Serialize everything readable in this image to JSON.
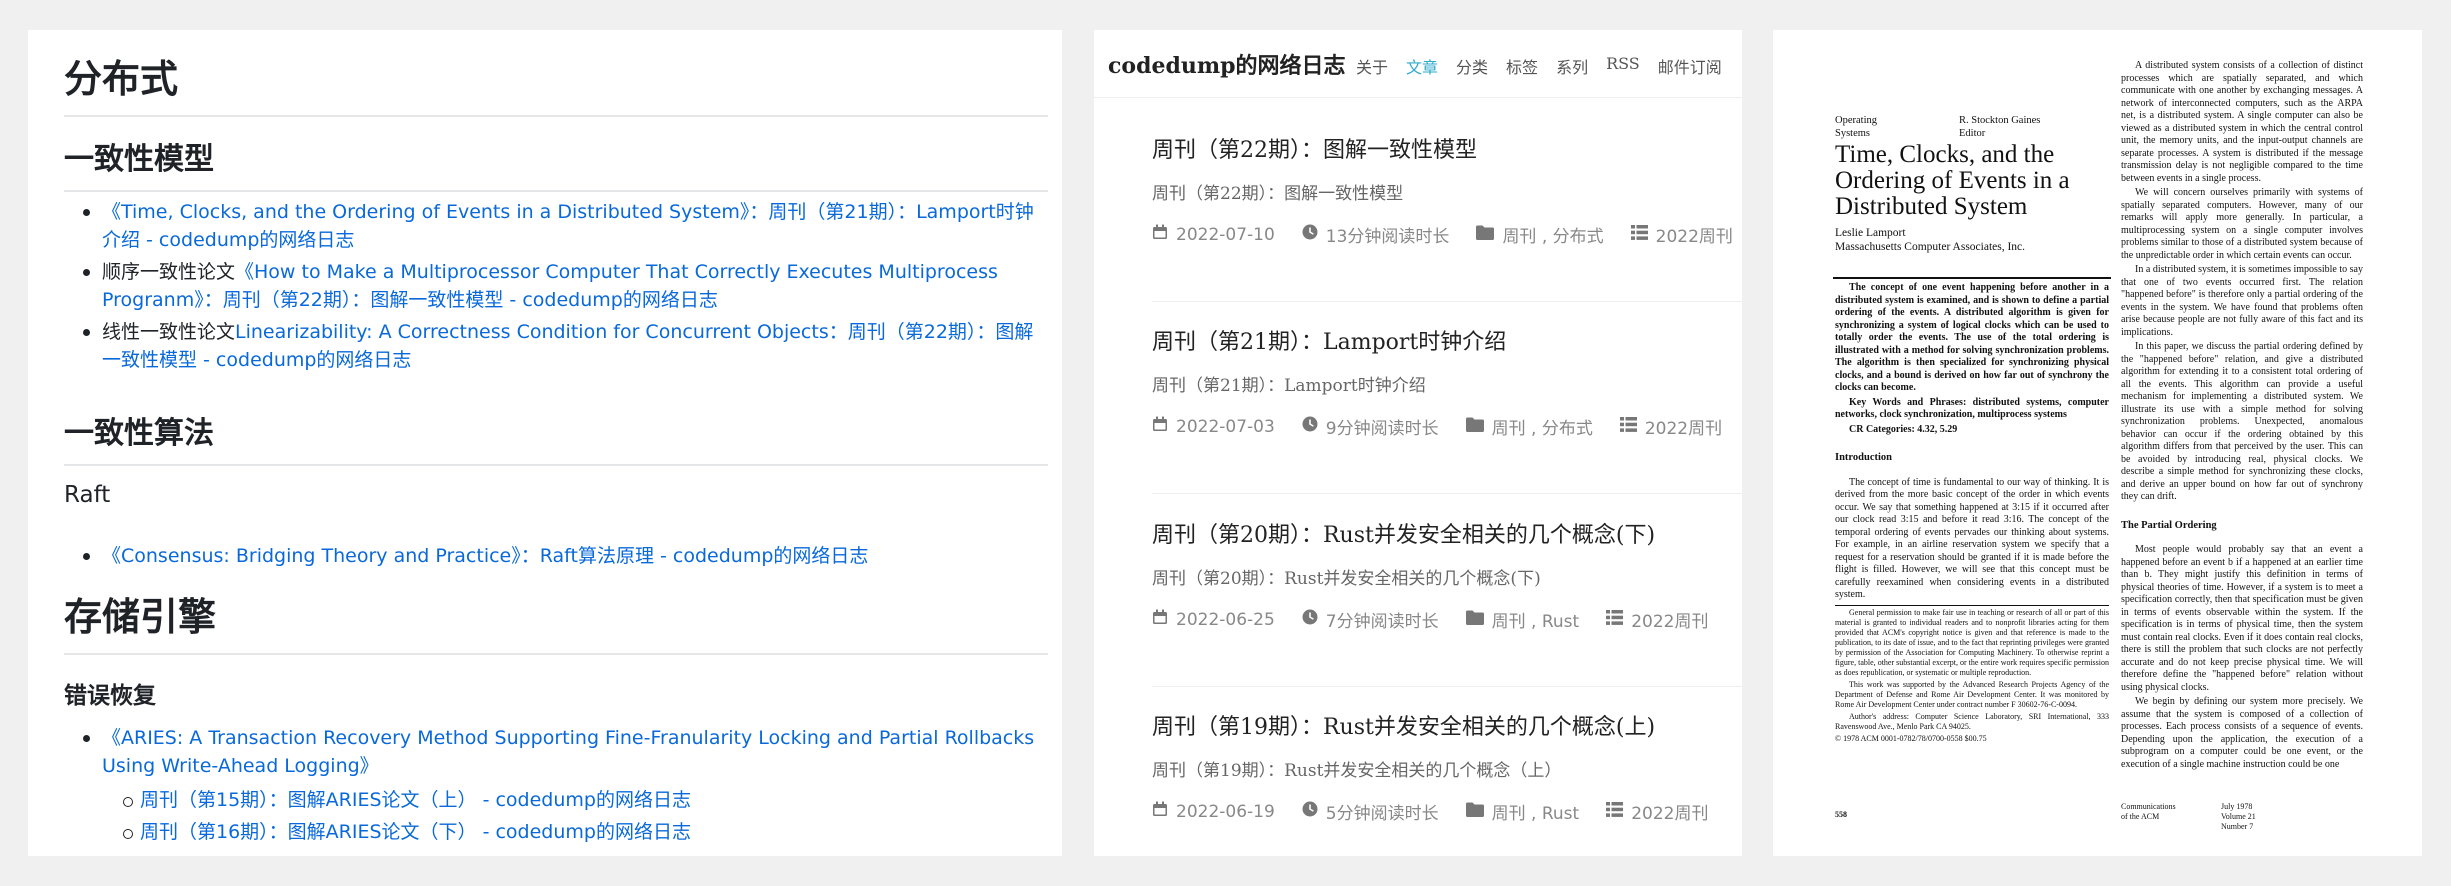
{
  "markdown_panel": {
    "h1_distributed": "分布式",
    "h2_consistency_model": "一致性模型",
    "consistency_items": [
      {
        "pre": "",
        "link": "《Time, Clocks, and the Ordering of Events in a Distributed System》：周刊（第21期）：Lamport时钟介绍 - codedump的网络日志"
      },
      {
        "pre": "顺序一致性论文",
        "link": "《How to Make a Multiprocessor Computer That Correctly Executes Multiprocess Progranm》：周刊（第22期）：图解一致性模型 - codedump的网络日志"
      },
      {
        "pre": "线性一致性论文",
        "link": "Linearizability: A Correctness Condition for Concurrent Objects：周刊（第22期）：图解一致性模型 - codedump的网络日志"
      }
    ],
    "h2_consistency_algo": "一致性算法",
    "h3_raft": "Raft",
    "raft_item": "《Consensus: Bridging Theory and Practice》：Raft算法原理 - codedump的网络日志",
    "h1_storage": "存储引擎",
    "h4_error_recovery": "错误恢复",
    "aries_item": "《ARIES: A Transaction Recovery Method Supporting Fine-Franularity Locking and Partial Rollbacks Using Write-Ahead Logging》",
    "aries_subitems": [
      "周刊（第15期）：图解ARIES论文（上） - codedump的网络日志",
      "周刊（第16期）：图解ARIES论文（下） - codedump的网络日志"
    ]
  },
  "blog_panel": {
    "site_title": "codedump的网络日志",
    "menu": [
      "关于",
      "文章",
      "分类",
      "标签",
      "系列",
      "RSS",
      "邮件订阅"
    ],
    "active_menu": "文章",
    "posts": [
      {
        "title": "周刊（第22期）：图解一致性模型",
        "subtitle": "周刊（第22期）：图解一致性模型",
        "date": "2022-07-10",
        "read": "13分钟阅读时长",
        "categories": "周刊 , 分布式",
        "series": "2022周刊"
      },
      {
        "title": "周刊（第21期）：Lamport时钟介绍",
        "subtitle": "周刊（第21期）：Lamport时钟介绍",
        "date": "2022-07-03",
        "read": "9分钟阅读时长",
        "categories": "周刊 , 分布式",
        "series": "2022周刊"
      },
      {
        "title": "周刊（第20期）：Rust并发安全相关的几个概念(下)",
        "subtitle": "周刊（第20期）：Rust并发安全相关的几个概念(下)",
        "date": "2022-06-25",
        "read": "7分钟阅读时长",
        "categories": "周刊 , Rust",
        "series": "2022周刊"
      },
      {
        "title": "周刊（第19期）：Rust并发安全相关的几个概念(上)",
        "subtitle": "周刊（第19期）：Rust并发安全相关的几个概念（上）",
        "date": "2022-06-19",
        "read": "5分钟阅读时长",
        "categories": "周刊 , Rust",
        "series": "2022周刊"
      }
    ]
  },
  "paper_panel": {
    "section_label_1": "Operating",
    "section_label_2": "Systems",
    "editor_name": "R. Stockton Gaines",
    "editor_label": "Editor",
    "title": "Time, Clocks, and the Ordering of Events in a Distributed System",
    "author": "Leslie Lamport",
    "affiliation": "Massachusetts Computer Associates, Inc.",
    "abstract": "The concept of one event happening before another in a distributed system is examined, and is shown to define a partial ordering of the events. A distributed algorithm is given for synchronizing a system of logical clocks which can be used to totally order the events. The use of the total ordering is illustrated with a method for solving synchronization problems. The algorithm is then specialized for synchronizing physical clocks, and a bound is derived on how far out of synchrony the clocks can become.",
    "keywords": "Key Words and Phrases: distributed systems, computer networks, clock synchronization, multiprocess systems",
    "cr_categories": "CR Categories: 4.32, 5.29",
    "intro_heading": "Introduction",
    "intro_text": "The concept of time is fundamental to our way of thinking. It is derived from the more basic concept of the order in which events occur. We say that something happened at 3:15 if it occurred after our clock read 3:15 and before it read 3:16. The concept of the temporal ordering of events pervades our thinking about systems. For example, in an airline reservation system we specify that a request for a reservation should be granted if it is made before the flight is filled. However, we will see that this concept must be carefully reexamined when considering events in a distributed system.",
    "permission": "General permission to make fair use in teaching or research of all or part of this material is granted to individual readers and to nonprofit libraries acting for them provided that ACM's copyright notice is given and that reference is made to the publication, to its date of issue, and to the fact that reprinting privileges were granted by permission of the Association for Computing Machinery. To otherwise reprint a figure, table, other substantial excerpt, or the entire work requires specific permission as does republication, or systematic or multiple reproduction.",
    "support": "This work was supported by the Advanced Research Projects Agency of the Department of Defense and Rome Air Development Center. It was monitored by Rome Air Development Center under contract number F 30602-76-C-0094.",
    "address": "Author's address: Computer Science Laboratory, SRI International, 333 Ravenswood Ave., Menlo Park CA 94025.",
    "copyright": "© 1978 ACM 0001-0782/78/0700-0558 $00.75",
    "page_number": "558",
    "footer_journal": "Communications of the ACM",
    "footer_date": "July 1978",
    "footer_volume": "Volume 21",
    "footer_number": "Number 7",
    "right_p1": "A distributed system consists of a collection of distinct processes which are spatially separated, and which communicate with one another by exchanging messages. A network of interconnected computers, such as the ARPA net, is a distributed system. A single computer can also be viewed as a distributed system in which the central control unit, the memory units, and the input-output channels are separate processes. A system is distributed if the message transmission delay is not negligible compared to the time between events in a single process.",
    "right_p2": "We will concern ourselves primarily with systems of spatially separated computers. However, many of our remarks will apply more generally. In particular, a multiprocessing system on a single computer involves problems similar to those of a distributed system because of the unpredictable order in which certain events can occur.",
    "right_p3": "In a distributed system, it is sometimes impossible to say that one of two events occurred first. The relation \"happened before\" is therefore only a partial ordering of the events in the system. We have found that problems often arise because people are not fully aware of this fact and its implications.",
    "right_p4": "In this paper, we discuss the partial ordering defined by the \"happened before\" relation, and give a distributed algorithm for extending it to a consistent total ordering of all the events. This algorithm can provide a useful mechanism for implementing a distributed system. We illustrate its use with a simple method for solving synchronization problems. Unexpected, anomalous behavior can occur if the ordering obtained by this algorithm differs from that perceived by the user. This can be avoided by introducing real, physical clocks. We describe a simple method for synchronizing these clocks, and derive an upper bound on how far out of synchrony they can drift.",
    "partial_heading": "The Partial Ordering",
    "right_p5": "Most people would probably say that an event a happened before an event b if a happened at an earlier time than b. They might justify this definition in terms of physical theories of time. However, if a system is to meet a specification correctly, then that specification must be given in terms of events observable within the system. If the specification is in terms of physical time, then the system must contain real clocks. Even if it does contain real clocks, there is still the problem that such clocks are not perfectly accurate and do not keep precise physical time. We will therefore define the \"happened before\" relation without using physical clocks.",
    "right_p6": "We begin by defining our system more precisely. We assume that the system is composed of a collection of processes. Each process consists of a sequence of events. Depending upon the application, the execution of a subprogram on a computer could be one event, or the execution of a single machine instruction could be one"
  }
}
